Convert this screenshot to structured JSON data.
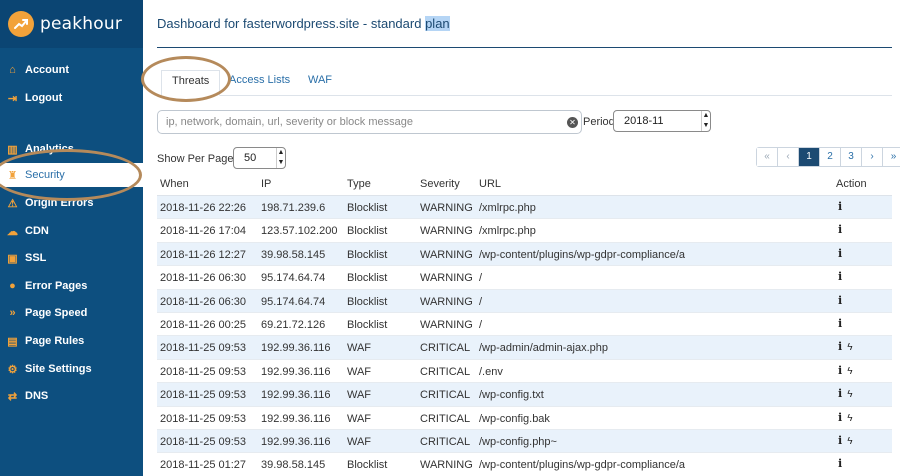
{
  "brand": {
    "name": "peakhour",
    "accent": "#f2a23a",
    "sidebar_bg": "#0d4f7f"
  },
  "sidebar": {
    "items": [
      {
        "label": "Account",
        "icon": "home-icon",
        "glyph": "⌂"
      },
      {
        "label": "Logout",
        "icon": "logout-icon",
        "glyph": "⇥"
      },
      {
        "label": "Analytics",
        "icon": "bar-chart-icon",
        "glyph": "▥"
      },
      {
        "label": "Security",
        "icon": "shield-icon",
        "glyph": "♜"
      },
      {
        "label": "Origin Errors",
        "icon": "warning-icon",
        "glyph": "⚠"
      },
      {
        "label": "CDN",
        "icon": "cloud-icon",
        "glyph": "☁"
      },
      {
        "label": "SSL",
        "icon": "lock-icon",
        "glyph": "🔒"
      },
      {
        "label": "Error Pages",
        "icon": "error-icon",
        "glyph": "●"
      },
      {
        "label": "Page Speed",
        "icon": "fast-forward-icon",
        "glyph": "»"
      },
      {
        "label": "Page Rules",
        "icon": "rules-icon",
        "glyph": "▤"
      },
      {
        "label": "Site Settings",
        "icon": "gear-icon",
        "glyph": "⚙"
      },
      {
        "label": "DNS",
        "icon": "shuffle-icon",
        "glyph": "⇄"
      }
    ]
  },
  "header": {
    "title_prefix": "Dashboard for fasterwordpress.site - standard ",
    "title_highlight": "plan"
  },
  "tabs": [
    {
      "label": "Threats"
    },
    {
      "label": "Access Lists"
    },
    {
      "label": "WAF"
    }
  ],
  "search": {
    "placeholder": "ip, network, domain, url, severity or block message",
    "value": ""
  },
  "period": {
    "label": "Period",
    "value": "2018-11"
  },
  "per_page": {
    "label": "Show Per Page:",
    "value": "50"
  },
  "pagination": {
    "first": "«",
    "prev": "‹",
    "pages": [
      "1",
      "2",
      "3"
    ],
    "next": "›",
    "last": "»",
    "current": "1"
  },
  "table": {
    "columns": [
      "When",
      "IP",
      "Type",
      "Severity",
      "URL",
      "Action"
    ],
    "rows": [
      {
        "when": "2018-11-26 22:26",
        "ip": "198.71.239.6",
        "type": "Blocklist",
        "severity": "WARNING",
        "url": "/xmlrpc.php",
        "actions": [
          "info"
        ]
      },
      {
        "when": "2018-11-26 17:04",
        "ip": "123.57.102.200",
        "type": "Blocklist",
        "severity": "WARNING",
        "url": "/xmlrpc.php",
        "actions": [
          "info"
        ]
      },
      {
        "when": "2018-11-26 12:27",
        "ip": "39.98.58.145",
        "type": "Blocklist",
        "severity": "WARNING",
        "url": "/wp-content/plugins/wp-gdpr-compliance/a",
        "actions": [
          "info"
        ]
      },
      {
        "when": "2018-11-26 06:30",
        "ip": "95.174.64.74",
        "type": "Blocklist",
        "severity": "WARNING",
        "url": "/",
        "actions": [
          "info"
        ]
      },
      {
        "when": "2018-11-26 06:30",
        "ip": "95.174.64.74",
        "type": "Blocklist",
        "severity": "WARNING",
        "url": "/",
        "actions": [
          "info"
        ]
      },
      {
        "when": "2018-11-26 00:25",
        "ip": "69.21.72.126",
        "type": "Blocklist",
        "severity": "WARNING",
        "url": "/",
        "actions": [
          "info"
        ]
      },
      {
        "when": "2018-11-25 09:53",
        "ip": "192.99.36.116",
        "type": "WAF",
        "severity": "CRITICAL",
        "url": "/wp-admin/admin-ajax.php",
        "actions": [
          "info",
          "bolt"
        ]
      },
      {
        "when": "2018-11-25 09:53",
        "ip": "192.99.36.116",
        "type": "WAF",
        "severity": "CRITICAL",
        "url": "/.env",
        "actions": [
          "info",
          "bolt"
        ]
      },
      {
        "when": "2018-11-25 09:53",
        "ip": "192.99.36.116",
        "type": "WAF",
        "severity": "CRITICAL",
        "url": "/wp-config.txt",
        "actions": [
          "info",
          "bolt"
        ]
      },
      {
        "when": "2018-11-25 09:53",
        "ip": "192.99.36.116",
        "type": "WAF",
        "severity": "CRITICAL",
        "url": "/wp-config.bak",
        "actions": [
          "info",
          "bolt"
        ]
      },
      {
        "when": "2018-11-25 09:53",
        "ip": "192.99.36.116",
        "type": "WAF",
        "severity": "CRITICAL",
        "url": "/wp-config.php~",
        "actions": [
          "info",
          "bolt"
        ]
      },
      {
        "when": "2018-11-25 01:27",
        "ip": "39.98.58.145",
        "type": "Blocklist",
        "severity": "WARNING",
        "url": "/wp-content/plugins/wp-gdpr-compliance/a",
        "actions": [
          "info"
        ]
      }
    ]
  }
}
